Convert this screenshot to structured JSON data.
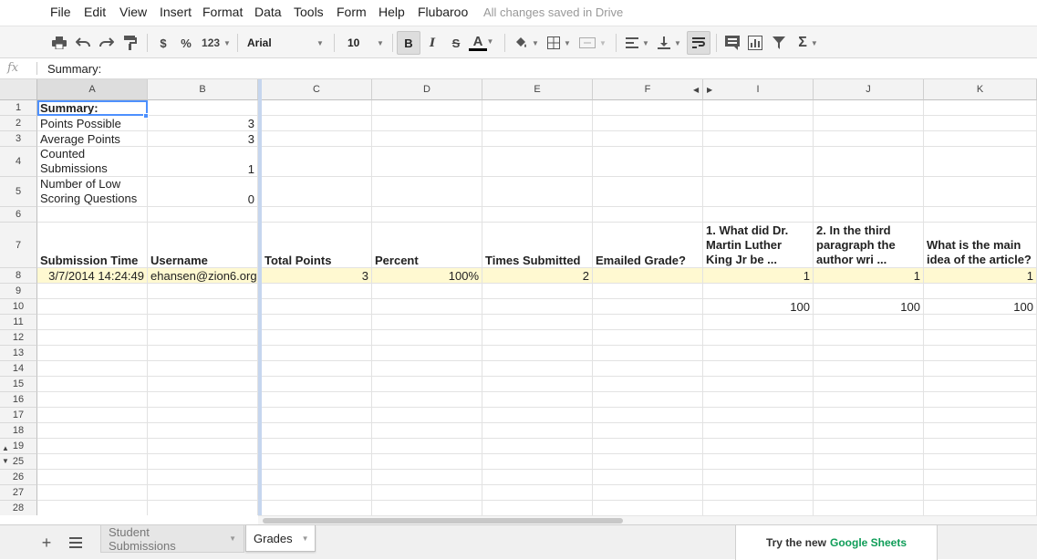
{
  "menu": {
    "items": [
      "File",
      "Edit",
      "View",
      "Insert",
      "Format",
      "Data",
      "Tools",
      "Form",
      "Help",
      "Flubaroo"
    ],
    "status": "All changes saved in Drive"
  },
  "toolbar": {
    "currency": "$",
    "percent": "%",
    "number_format": "123",
    "font": "Arial",
    "font_size": "10",
    "bold": "B",
    "italic": "I",
    "strikethrough": "S",
    "text_color": "A",
    "sum": "Σ"
  },
  "formula_bar": {
    "fx": "fx",
    "value": "Summary:"
  },
  "columns": [
    "A",
    "B",
    "C",
    "D",
    "E",
    "F",
    "I",
    "J",
    "K"
  ],
  "rows": [
    "1",
    "2",
    "3",
    "4",
    "5",
    "6",
    "7",
    "8",
    "9",
    "10",
    "11",
    "12",
    "13",
    "14",
    "15",
    "16",
    "17",
    "18",
    "19",
    "25",
    "26",
    "27",
    "28"
  ],
  "cells": {
    "A1": "Summary:",
    "A2": "Points Possible",
    "B2": "3",
    "A3": "Average Points",
    "B3": "3",
    "A4": "Counted Submissions",
    "B4": "1",
    "A5": "Number of Low Scoring Questions",
    "B5": "0",
    "A7": "Submission Time",
    "B7": "Username",
    "C7": "Total Points",
    "D7": "Percent",
    "E7": "Times Submitted",
    "F7": "Emailed Grade?",
    "I7": "1. What did Dr. Martin Luther King Jr be ...",
    "J7": "2. In the third paragraph the author wri ...",
    "K7": "What is the main idea of the article?",
    "A8": "3/7/2014 14:24:49",
    "B8": "ehansen@zion6.org",
    "C8": "3",
    "D8": "100%",
    "E8": "2",
    "I8": "1",
    "J8": "1",
    "K8": "1",
    "I10": "100",
    "J10": "100",
    "K10": "100"
  },
  "sheets": {
    "tabs": [
      "Student Submissions",
      "Grades"
    ],
    "active": "Grades"
  },
  "promo": {
    "prefix": "Try the new",
    "brand": "Google Sheets",
    "brand_color": "#0f9d58"
  },
  "colors": {
    "highlight_row": "#fff9d1",
    "selection": "#4d90fe"
  }
}
